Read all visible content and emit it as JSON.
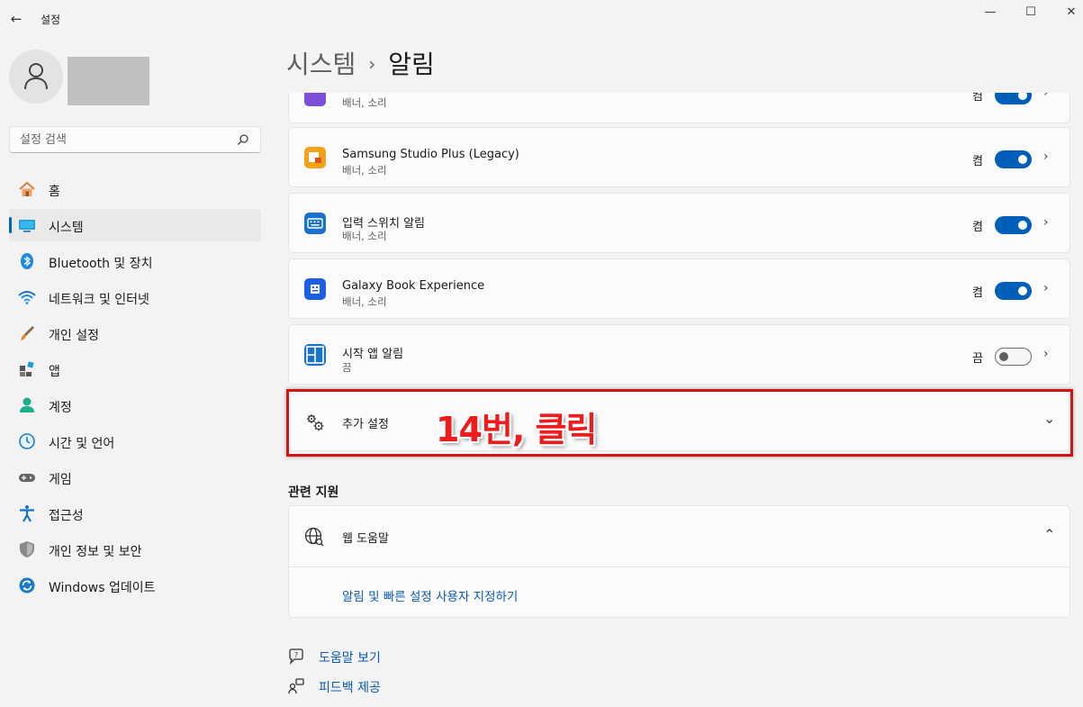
{
  "window": {
    "title": "설정",
    "back_glyph": "←",
    "minimize_glyph": "—",
    "maximize_glyph": "☐",
    "close_glyph": "✕"
  },
  "sidebar": {
    "search_placeholder": "설정 검색",
    "items": [
      {
        "label": "홈",
        "icon": "home-icon",
        "active": false
      },
      {
        "label": "시스템",
        "icon": "system-monitor-icon",
        "active": true
      },
      {
        "label": "Bluetooth 및 장치",
        "icon": "bluetooth-icon",
        "active": false
      },
      {
        "label": "네트워크 및 인터넷",
        "icon": "wifi-icon",
        "active": false
      },
      {
        "label": "개인 설정",
        "icon": "brush-icon",
        "active": false
      },
      {
        "label": "앱",
        "icon": "apps-icon",
        "active": false
      },
      {
        "label": "계정",
        "icon": "account-icon",
        "active": false
      },
      {
        "label": "시간 및 언어",
        "icon": "time-language-icon",
        "active": false
      },
      {
        "label": "게임",
        "icon": "gamepad-icon",
        "active": false
      },
      {
        "label": "접근성",
        "icon": "accessibility-icon",
        "active": false
      },
      {
        "label": "개인 정보 및 보안",
        "icon": "shield-icon",
        "active": false
      },
      {
        "label": "Windows 업데이트",
        "icon": "update-icon",
        "active": false
      }
    ]
  },
  "breadcrumb": {
    "parent": "시스템",
    "separator": "›",
    "current": "알림"
  },
  "apps": [
    {
      "name": "",
      "sub": "배너, 소리",
      "state": "켬",
      "on": true,
      "icon": "purple-app-icon"
    },
    {
      "name": "Samsung Studio Plus (Legacy)",
      "sub": "배너, 소리",
      "state": "켬",
      "on": true,
      "icon": "samsung-studio-plus-icon"
    },
    {
      "name": "입력 스위치 알림",
      "sub": "배너, 소리",
      "state": "켬",
      "on": true,
      "icon": "keyboard-switch-icon"
    },
    {
      "name": "Galaxy Book Experience",
      "sub": "배너, 소리",
      "state": "켬",
      "on": true,
      "icon": "galaxy-book-icon"
    },
    {
      "name": "시작 앱 알림",
      "sub": "끔",
      "state": "끔",
      "on": false,
      "icon": "startup-apps-icon"
    }
  ],
  "additional": {
    "label": "추가 설정",
    "chevron": "⌄"
  },
  "related": {
    "title": "관련 지원",
    "web_help": "웹 도움말",
    "link": "알림 및 빠른 설정 사용자 지정하기"
  },
  "footer": {
    "get_help": "도움말 보기",
    "feedback": "피드백 제공"
  },
  "annotation": {
    "text": "14번, 클릭",
    "color": "#ee1c1c"
  },
  "colors": {
    "accent": "#005fb8",
    "link": "#0a5bb5",
    "background": "#f3f3f3",
    "card": "#fbfbfb"
  }
}
